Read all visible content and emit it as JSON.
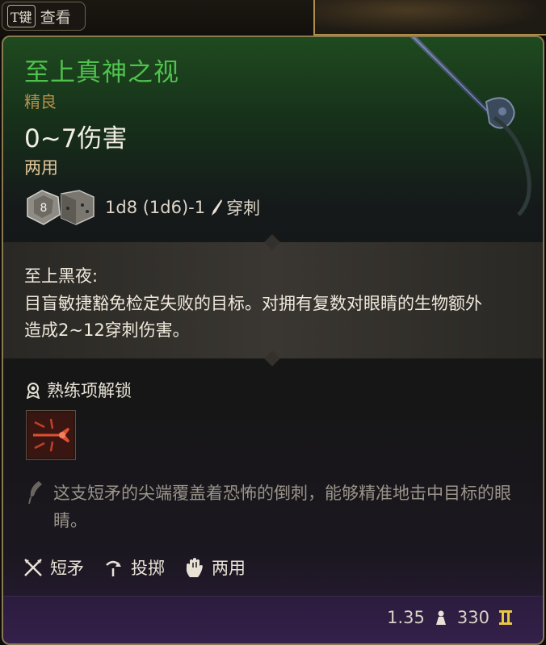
{
  "topbar": {
    "key": "T键",
    "label": "查看"
  },
  "item": {
    "name": "至上真神之视",
    "rarity": "精良",
    "damage": "0~7伤害",
    "handedness": "两用",
    "dice_formula": "1d8 (1d6)-1",
    "dice_value": "8",
    "damage_type": "穿刺"
  },
  "ability": {
    "name": "至上黑夜:",
    "description": "目盲敏捷豁免检定失败的目标。对拥有复数对眼睛的生物额外造成2~12穿刺伤害。"
  },
  "proficiency": {
    "heading": "熟练项解锁"
  },
  "flavor": "这支短矛的尖端覆盖着恐怖的倒刺，能够精准地击中目标的眼睛。",
  "tags": [
    {
      "icon": "spear-icon",
      "label": "短矛"
    },
    {
      "icon": "throw-icon",
      "label": "投掷"
    },
    {
      "icon": "hand-icon",
      "label": "两用"
    }
  ],
  "footer": {
    "weight": "1.35",
    "value": "330"
  },
  "colors": {
    "title": "#4fc24d",
    "rarity": "#b8904a",
    "border": "#8a7a52"
  }
}
